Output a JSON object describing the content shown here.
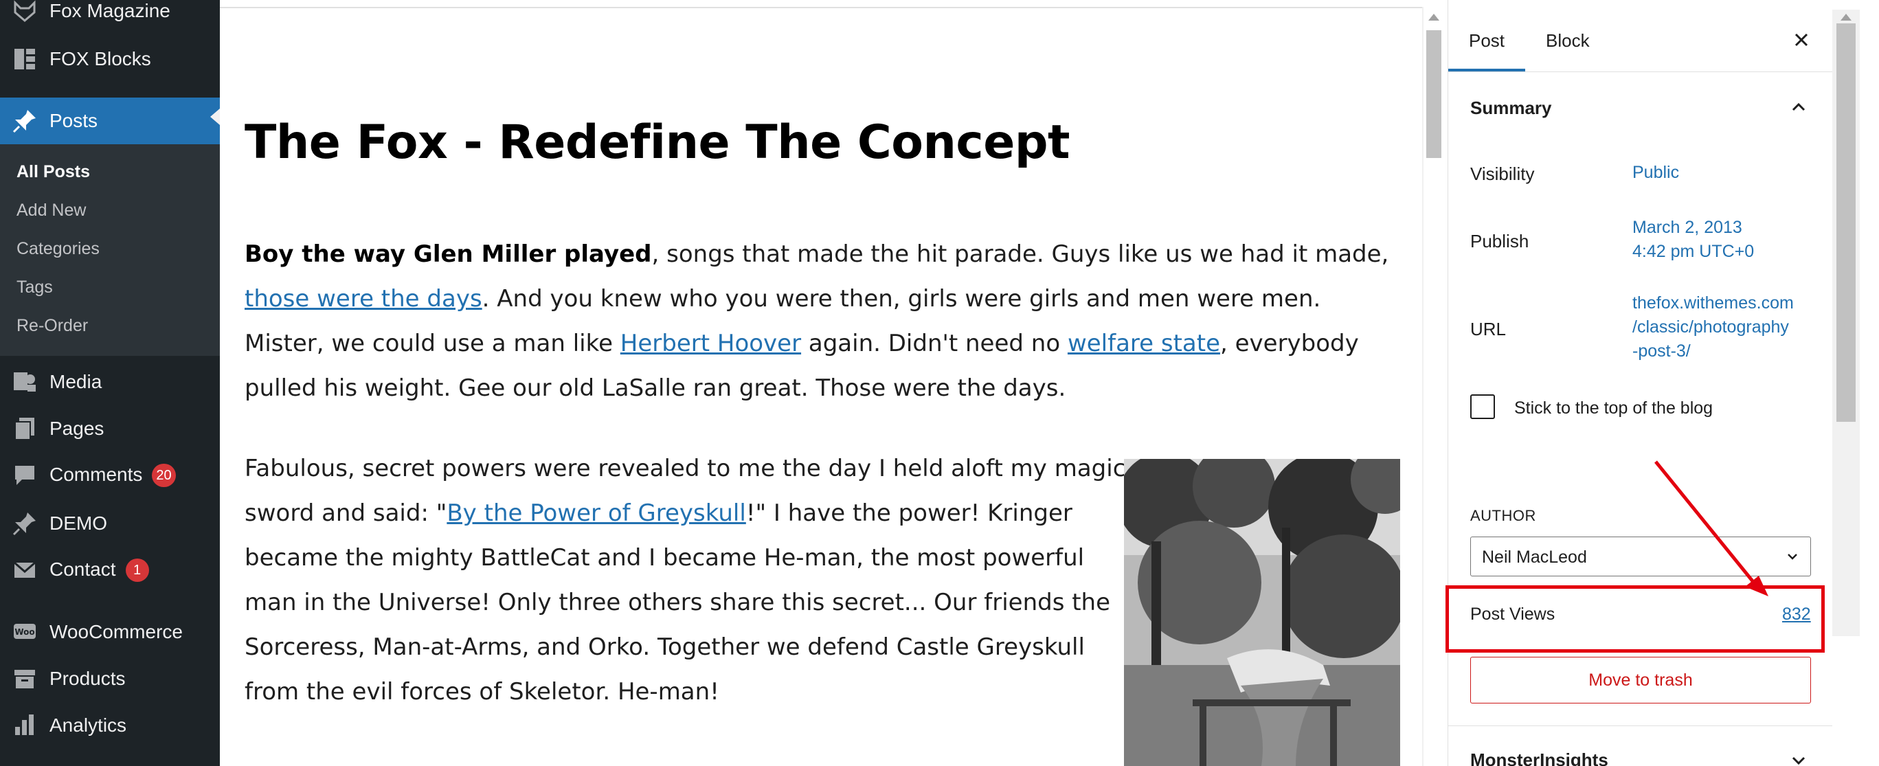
{
  "sidebar": {
    "items": [
      {
        "label": "Fox Magazine",
        "icon": "fox-icon"
      },
      {
        "label": "FOX Blocks",
        "icon": "blocks-icon"
      },
      {
        "label": "Posts",
        "icon": "pin-icon",
        "active": true
      },
      {
        "label": "Media",
        "icon": "media-icon"
      },
      {
        "label": "Pages",
        "icon": "pages-icon"
      },
      {
        "label": "Comments",
        "icon": "comments-icon",
        "badge": "20"
      },
      {
        "label": "DEMO",
        "icon": "pin-icon"
      },
      {
        "label": "Contact",
        "icon": "mail-icon",
        "badge": "1"
      },
      {
        "label": "WooCommerce",
        "icon": "woo-icon"
      },
      {
        "label": "Products",
        "icon": "archive-icon"
      },
      {
        "label": "Analytics",
        "icon": "bar-chart-icon"
      }
    ],
    "submenu": [
      "All Posts",
      "Add New",
      "Categories",
      "Tags",
      "Re-Order"
    ]
  },
  "editor": {
    "title": "The Fox - Redefine The Concept",
    "para1": {
      "bold": "Boy the way Glen Miller played",
      "t1": ", songs that made the hit parade. Guys like us we had it made, ",
      "link1": "those were the days",
      "t2": ". And you knew who you were then, girls were girls and men were men. Mister, we could use a man like ",
      "link2": "Herbert Hoover",
      "t3": " again. Didn't need no ",
      "link3": "welfare state",
      "t4": ", everybody pulled his weight. Gee our old LaSalle ran great. Those were the days."
    },
    "para2": {
      "t1": "Fabulous, secret powers were revealed to me the day I held aloft my magic sword and said: \"",
      "link1": "By the Power of Greyskull",
      "t2": "!\" I have the power! Kringer became the mighty BattleCat and I became He-man, the most powerful man in the Universe! Only three others share this secret... Our friends the Sorceress, Man-at-Arms, and Orko. Together we defend Castle Greyskull from the evil forces of Skeletor. He-man!"
    }
  },
  "settings": {
    "tabs": {
      "post": "Post",
      "block": "Block"
    },
    "summary": "Summary",
    "visibility": {
      "label": "Visibility",
      "value": "Public"
    },
    "publish": {
      "label": "Publish",
      "line1": "March 2, 2013",
      "line2": "4:42 pm UTC+0"
    },
    "url": {
      "label": "URL",
      "line1": "thefox.withemes.com",
      "line2": "/classic/photography",
      "line3": "-post-3/"
    },
    "stick": "Stick to the top of the blog",
    "author": {
      "heading": "AUTHOR",
      "value": "Neil MacLeod"
    },
    "post_views": {
      "label": "Post Views",
      "value": "832"
    },
    "trash": "Move to trash",
    "monsterinsights": "MonsterInsights"
  },
  "colors": {
    "admin_bg": "#1d2327",
    "submenu_bg": "#2c3338",
    "accent": "#2271b1",
    "badge": "#d63638",
    "danger": "#cc1818",
    "annotation": "#e3000f"
  }
}
